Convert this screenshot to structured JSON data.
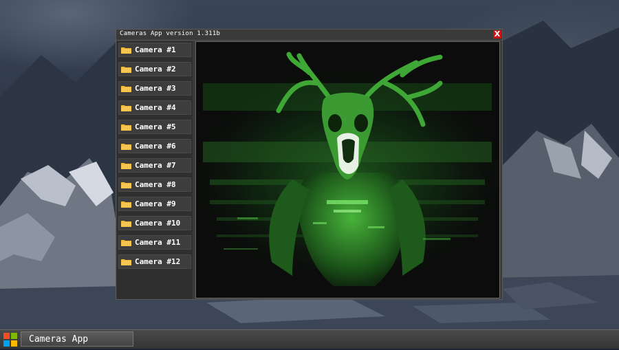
{
  "window": {
    "title": "Cameras App version 1.311b",
    "close_label": "X"
  },
  "cameras": [
    {
      "label": "Camera #1"
    },
    {
      "label": "Camera #2"
    },
    {
      "label": "Camera #3"
    },
    {
      "label": "Camera #4"
    },
    {
      "label": "Camera #5"
    },
    {
      "label": "Camera #6"
    },
    {
      "label": "Camera #7"
    },
    {
      "label": "Camera #8"
    },
    {
      "label": "Camera #9"
    },
    {
      "label": "Camera #10"
    },
    {
      "label": "Camera #11"
    },
    {
      "label": "Camera #12"
    }
  ],
  "taskbar": {
    "app_label": "Cameras App",
    "start_icon": "windows-logo-icon"
  },
  "colors": {
    "close": "#c81414",
    "feed_green": "#39d33a",
    "folder": "#f2b531"
  }
}
